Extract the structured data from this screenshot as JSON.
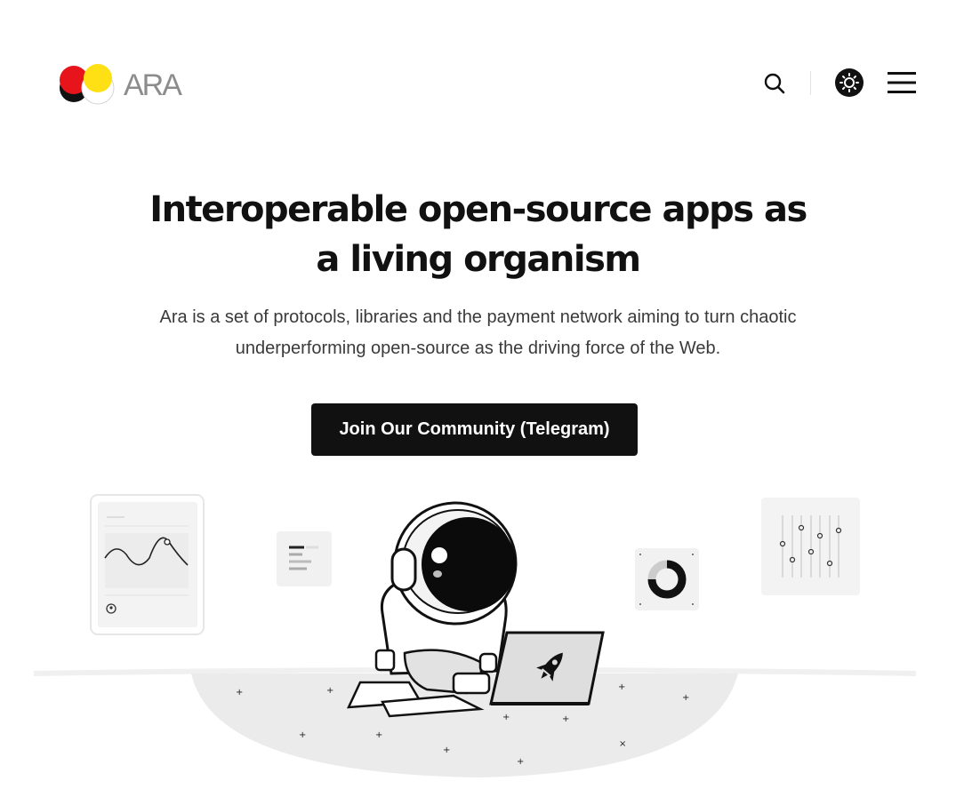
{
  "header": {
    "logo_text": "ARA",
    "icons": {
      "search": "search-icon",
      "theme": "sun-icon",
      "menu": "hamburger-menu-icon"
    }
  },
  "hero": {
    "title": "Interoperable open-source apps as a living organism",
    "description": "Ara is a set of protocols, libraries and the payment network aiming to turn chaotic underperforming open-source as the driving force of the Web.",
    "cta_label": "Join Our Community (Telegram)"
  },
  "illustration": {
    "subject": "astronaut-with-laptop",
    "icons": [
      "line-chart-card",
      "text-list-card",
      "donut-chart-card",
      "sliders-card",
      "rocket-icon"
    ]
  },
  "colors": {
    "logo_red": "#e8141b",
    "logo_yellow": "#ffe014",
    "logo_black": "#111111",
    "logo_text": "#8c8c8c",
    "button_bg": "#111111",
    "text_dark": "#111111",
    "text_body": "#3a3a3a"
  }
}
